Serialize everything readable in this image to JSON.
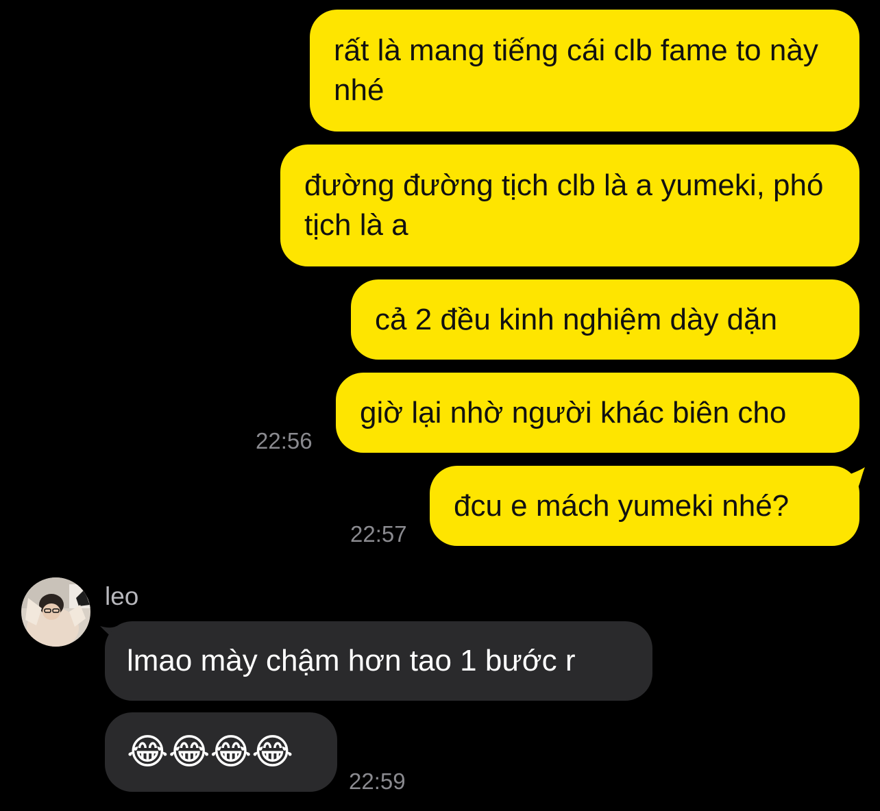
{
  "conversation": {
    "sent_messages": [
      {
        "text": "rất là mang tiếng cái clb fame to này nhé"
      },
      {
        "text": "đường đường tịch clb là a yumeki, phó tịch là a"
      },
      {
        "text": "cả 2 đều kinh nghiệm dày dặn"
      },
      {
        "text": "giờ lại nhờ người khác biên cho",
        "time": "22:56"
      },
      {
        "text": "đcu e mách yumeki nhé?",
        "time": "22:57"
      }
    ],
    "received": {
      "sender": "leo",
      "messages": [
        {
          "text": "lmao mày chậm hơn tao 1 bước r"
        },
        {
          "emoji": "😂😂😂😂",
          "time": "22:59"
        }
      ]
    }
  },
  "colors": {
    "background": "#000000",
    "sent_bubble": "#FEE500",
    "received_bubble": "#2A2A2C",
    "timestamp": "#8A8A8F"
  }
}
